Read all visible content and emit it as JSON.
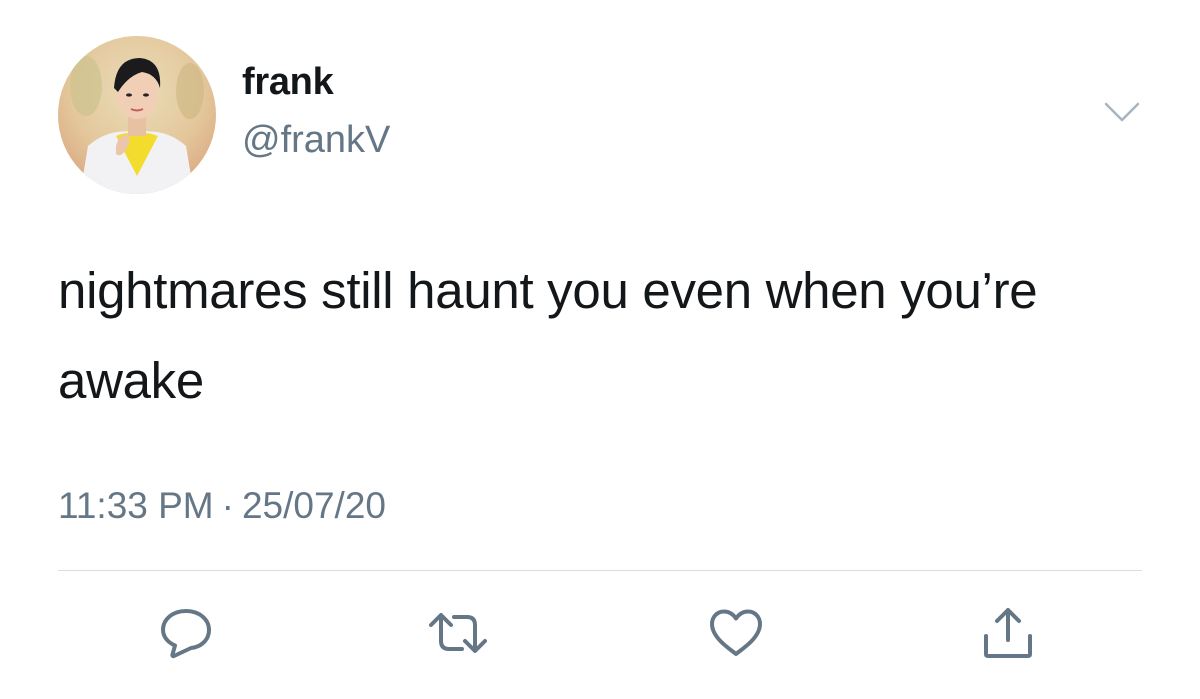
{
  "tweet": {
    "author": {
      "display_name": "frank",
      "handle": "@frankV",
      "avatar_icon": "profile-photo"
    },
    "text": "nightmares still haunt you even when you’re awake",
    "time": "11:33 PM",
    "separator": "·",
    "date": "25/07/20",
    "menu_icon": "chevron-down-icon",
    "actions": [
      {
        "name": "reply",
        "icon": "reply-icon"
      },
      {
        "name": "retweet",
        "icon": "retweet-icon"
      },
      {
        "name": "like",
        "icon": "heart-icon"
      },
      {
        "name": "share",
        "icon": "share-icon"
      }
    ]
  },
  "colors": {
    "text_primary": "#14171a",
    "text_secondary": "#657786",
    "divider": "#d8dde1"
  }
}
